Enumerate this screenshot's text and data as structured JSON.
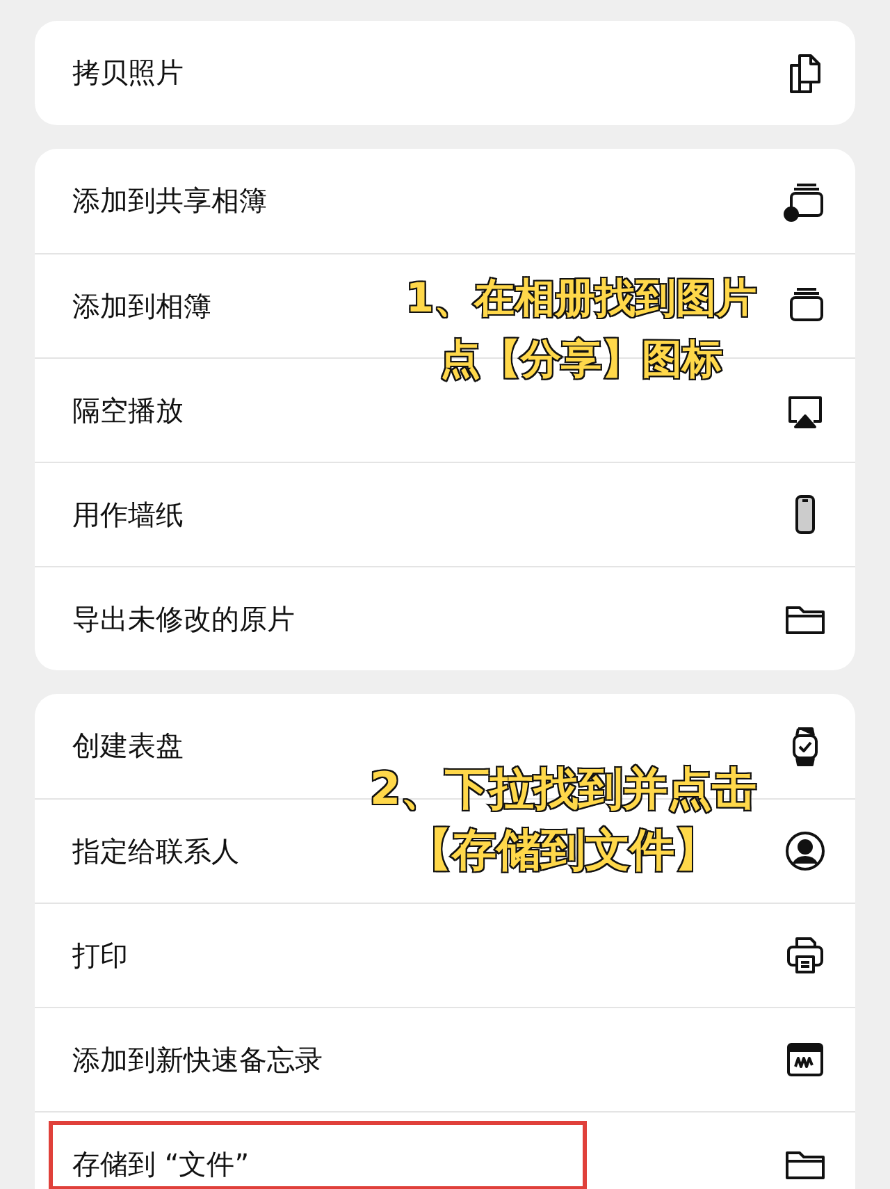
{
  "groups": [
    {
      "items": [
        {
          "label": "拷贝照片",
          "kind": "copy",
          "highlighted": false
        }
      ]
    },
    {
      "items": [
        {
          "label": "添加到共享相簿",
          "kind": "shared-album",
          "highlighted": false
        },
        {
          "label": "添加到相簿",
          "kind": "album",
          "highlighted": false
        },
        {
          "label": "隔空播放",
          "kind": "airplay",
          "highlighted": false
        },
        {
          "label": "用作墙纸",
          "kind": "phone",
          "highlighted": false
        },
        {
          "label": "导出未修改的原片",
          "kind": "folder",
          "highlighted": false
        }
      ]
    },
    {
      "items": [
        {
          "label": "创建表盘",
          "kind": "watch",
          "highlighted": false
        },
        {
          "label": "指定给联系人",
          "kind": "contact",
          "highlighted": false
        },
        {
          "label": "打印",
          "kind": "printer",
          "highlighted": false
        },
        {
          "label": "添加到新快速备忘录",
          "kind": "note",
          "highlighted": false
        },
        {
          "label": "存储到 “文件”",
          "kind": "folder",
          "highlighted": true
        }
      ]
    }
  ],
  "annotations": [
    {
      "lines": [
        "1、在相册找到图片",
        "点【分享】图标"
      ]
    },
    {
      "lines": [
        "2、下拉找到并点击",
        "【存储到文件】"
      ]
    }
  ]
}
